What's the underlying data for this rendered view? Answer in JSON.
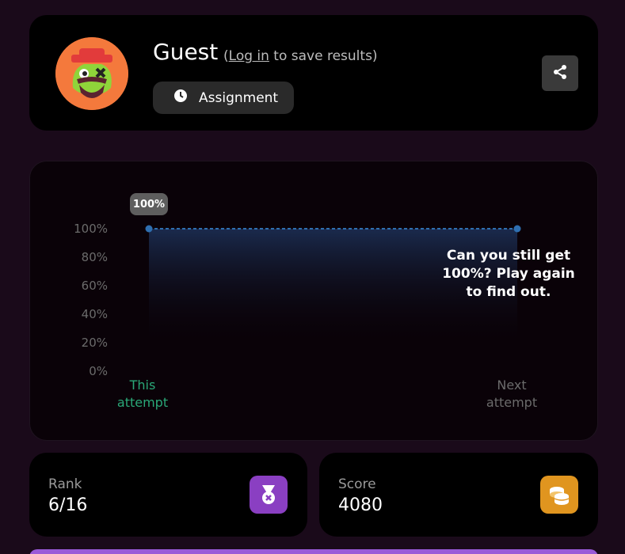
{
  "header": {
    "username": "Guest",
    "login_open": "(",
    "login_link": "Log in",
    "login_rest": " to save results)",
    "assignment_label": "Assignment"
  },
  "chart_data": {
    "type": "line",
    "categories": [
      "This attempt",
      "Next attempt"
    ],
    "series": [
      {
        "values": [
          100,
          100
        ]
      }
    ],
    "ylim": [
      0,
      100
    ],
    "yticks": [
      "100%",
      "80%",
      "60%",
      "40%",
      "20%",
      "0%"
    ],
    "point_label": "100%",
    "annotation": "Can you still get 100%? Play again to find out.",
    "colors": {
      "line": "#2f6fb0",
      "this_attempt": "#2aa878",
      "next_attempt": "#6b6b6b"
    }
  },
  "stats": {
    "rank": {
      "label": "Rank",
      "value": "6/16",
      "icon": "medal-icon",
      "color": "#8a3fc2"
    },
    "score": {
      "label": "Score",
      "value": "4080",
      "icon": "coins-icon",
      "color": "#e0951f"
    }
  }
}
